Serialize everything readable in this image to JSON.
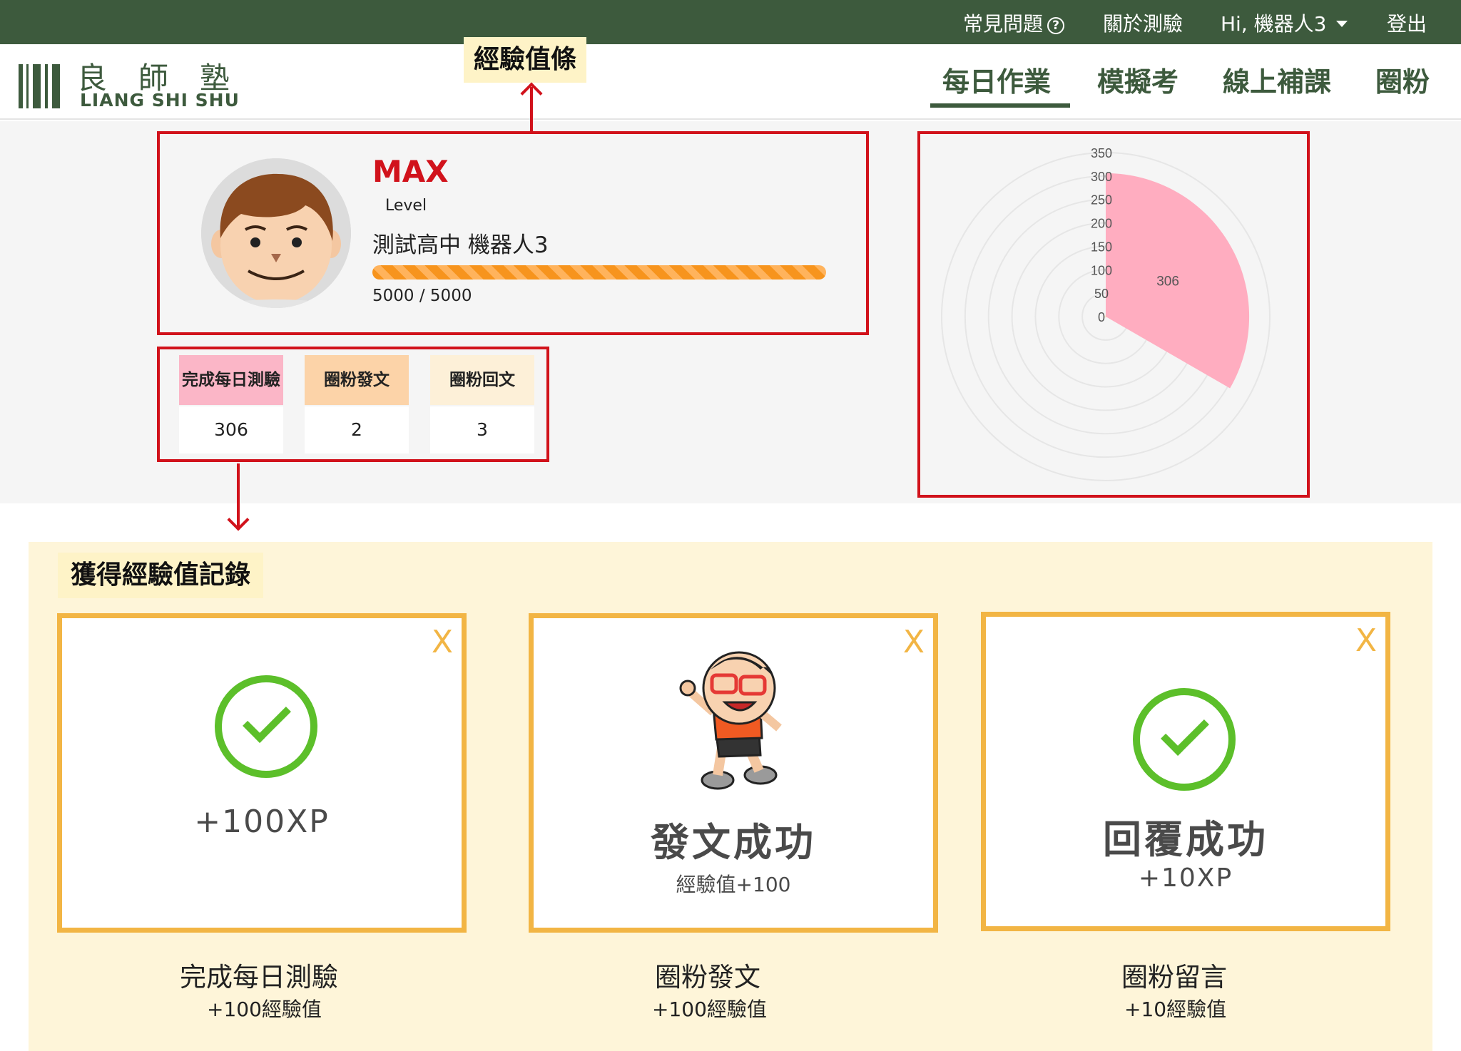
{
  "topbar": {
    "faq": "常見問題",
    "about": "關於測驗",
    "user_greeting": "Hi, 機器人3",
    "logout": "登出"
  },
  "logo": {
    "chinese": "良師塾",
    "english": "LIANG SHI SHU"
  },
  "nav": {
    "tabs": [
      "每日作業",
      "模擬考",
      "線上補課",
      "圈粉"
    ],
    "active": "每日作業"
  },
  "callouts": {
    "xp_bar": "經驗值條",
    "record": "獲得經驗值記錄"
  },
  "profile": {
    "level": "MAX",
    "level_label": "Level",
    "school_user": "測試高中 機器人3",
    "xp_current": "5000",
    "xp_sep": "/",
    "xp_max": "5000",
    "xp_fraction": 1.0
  },
  "stats": [
    {
      "label": "完成每日測驗",
      "value": "306",
      "color": "#fbb6c7"
    },
    {
      "label": "圈粉發文",
      "value": "2",
      "color": "#fcd3a8"
    },
    {
      "label": "圈粉回文",
      "value": "3",
      "color": "#fdf0d8"
    }
  ],
  "chart_data": {
    "type": "polar-area",
    "radial_ticks": [
      "350",
      "300",
      "250",
      "200",
      "150",
      "100",
      "50",
      "0"
    ],
    "rmax": 350,
    "slices": [
      {
        "value": 306,
        "color": "#ffadc0",
        "label": "306"
      },
      {
        "value": 2,
        "color": "#fcd3a8",
        "label": ""
      },
      {
        "value": 3,
        "color": "#fdf0d8",
        "label": ""
      }
    ]
  },
  "records": [
    {
      "main": "+100XP",
      "sub": "",
      "caption_title": "完成每日測驗",
      "caption_value": "+100經驗值",
      "type": "check"
    },
    {
      "main": "發文成功",
      "sub": "經驗值+100",
      "caption_title": "圈粉發文",
      "caption_value": "+100經驗值",
      "type": "mascot"
    },
    {
      "main": "回覆成功",
      "sub": "+10XP",
      "caption_title": "圈粉留言",
      "caption_value": "+10經驗值",
      "type": "check"
    }
  ],
  "close_glyph": "X",
  "colors": {
    "brand_green": "#3d5a3d",
    "accent_red": "#d1121b",
    "xp_orange": "#f7941d",
    "card_border": "#f2b544",
    "check_green": "#5cbf2a"
  }
}
